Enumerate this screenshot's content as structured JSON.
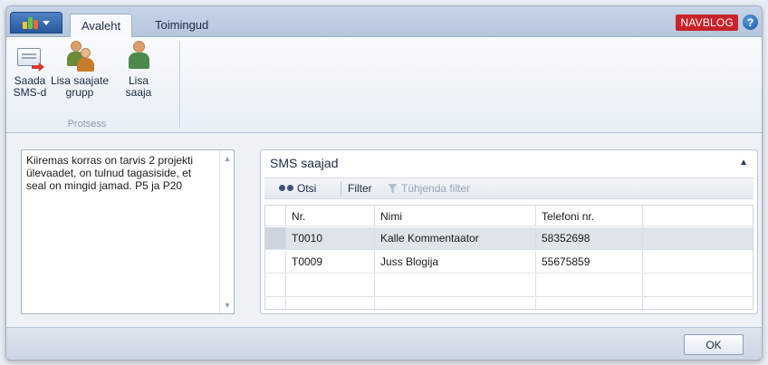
{
  "ribbon": {
    "tabs": [
      "Avaleht",
      "Toimingud"
    ],
    "badge": "NAVBLOG",
    "help": "?",
    "buttons": {
      "send_sms": "Saada\nSMS-d",
      "add_group": "Lisa saajate\ngrupp",
      "add_recipient": "Lisa\nsaaja"
    },
    "group_label": "Protsess"
  },
  "notes": {
    "text": "Kiiremas korras on tarvis 2 projekti ülevaadet, on tulnud tagasiside, et seal on mingid jamad. P5 ja P20"
  },
  "panel": {
    "title": "SMS saajad",
    "toolbar": {
      "find": "Otsi",
      "filter": "Filter",
      "clear_filter": "Tühjenda filter"
    },
    "columns": [
      "Nr.",
      "Nimi",
      "Telefoni nr."
    ],
    "rows": [
      {
        "nr": "T0010",
        "name": "Kalle Kommentaator",
        "phone": "58352698"
      },
      {
        "nr": "T0009",
        "name": "Juss Blogija",
        "phone": "55675859"
      }
    ]
  },
  "footer": {
    "ok": "OK"
  },
  "colors": {
    "badge": "#c8232b",
    "app_button": "#27589b",
    "selected_row": "#dfe4ea"
  }
}
